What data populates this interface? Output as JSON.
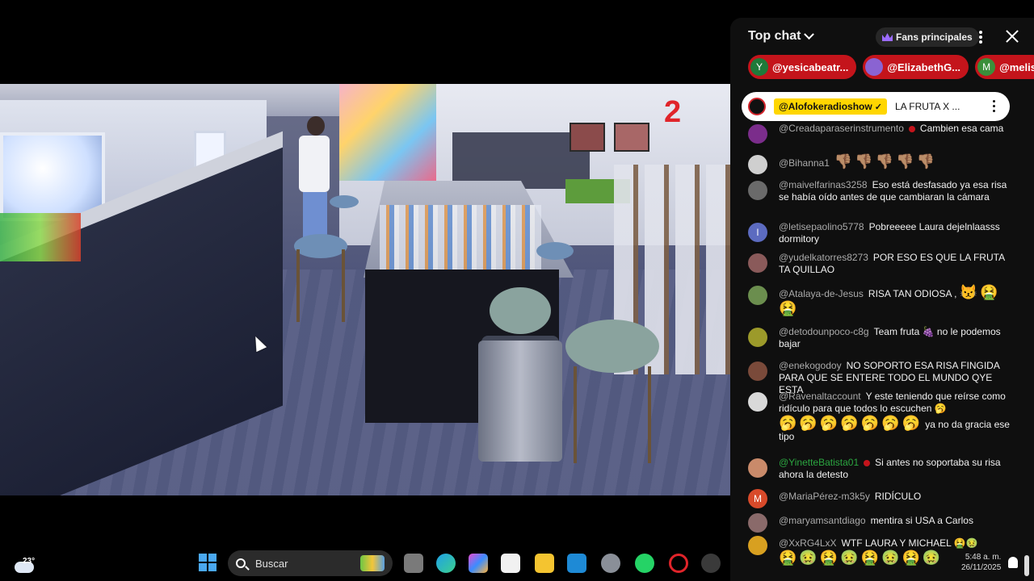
{
  "chat": {
    "title": "Top chat",
    "fans_label": "Fans principales",
    "donors": [
      {
        "initial": "Y",
        "name": "@yesicabeatr...",
        "avatar_color": "#1f7a3a"
      },
      {
        "initial": "",
        "name": "@ElizabethG...",
        "avatar_color": "#8a63d2"
      },
      {
        "initial": "M",
        "name": "@melis",
        "avatar_color": "#3a8f3a"
      }
    ],
    "pinned": {
      "name": "@Alofokeradioshow",
      "check": "✓",
      "text": "LA FRUTA X ..."
    },
    "messages": [
      {
        "author": "@Creadaparaserinstrumento",
        "text": "Cambien esa cama",
        "avatar_color": "#7b2d8b",
        "initial": ""
      },
      {
        "author": "@Bihanna1",
        "text": "",
        "emoji": "👎🏽👎🏽👎🏽👎🏽👎🏽",
        "avatar_color": "#cfcfcf",
        "initial": ""
      },
      {
        "author": "@maivelfarinas3258",
        "text": "Eso está desfasado ya esa risa se había oído antes de que cambiaran la cámara",
        "avatar_color": "#6a6a6a",
        "initial": ""
      },
      {
        "author": "@letisepaolino5778",
        "text": "Pobreeeee Laura dejelnlaasss dormitory",
        "avatar_color": "#5c6bc0",
        "initial": "l"
      },
      {
        "author": "@yudelkatorres8273",
        "text": "POR ESO ES QUE LA FRUTA TA QUILLAO",
        "avatar_color": "#8a5a5a",
        "initial": ""
      },
      {
        "author": "@Atalaya-de-Jesus",
        "text": "RISA TAN ODIOSA ,",
        "emoji": "😾🤮 🤮",
        "avatar_color": "#6b8e4e",
        "initial": ""
      },
      {
        "author": "@detodounpoco-c8g",
        "text": "Team fruta 🍇 no le podemos bajar",
        "avatar_color": "#9c9a2a",
        "initial": ""
      },
      {
        "author": "@enekogodoy",
        "text": "NO SOPORTO ESA RISA FINGIDA PARA QUE SE ENTERE TODO EL MUNDO QYE ESTA",
        "avatar_color": "#7a4a3a",
        "initial": ""
      },
      {
        "author": "@Ravenaltaccount",
        "text": "Y este teniendo que reírse como ridículo para que todos lo escuchen 🥱",
        "emoji": "🥱🥱🥱🥱🥱🥱🥱",
        "tail": "ya no da gracia ese tipo",
        "avatar_color": "#d9d9d9",
        "initial": ""
      },
      {
        "author": "@YinetteBatista01",
        "text": "Si antes no soportaba su risa ahora la detesto",
        "avatar_color": "#c98a6a",
        "initial": "",
        "green": true
      },
      {
        "author": "@MariaPérez-m3k5y",
        "text": "RIDÍCULO",
        "avatar_color": "#d84a2a",
        "initial": "M"
      },
      {
        "author": "@maryamsantdiago",
        "text": "mentira si USA a Carlos",
        "avatar_color": "#8a6a6a",
        "initial": ""
      },
      {
        "author": "@XxRG4LxX",
        "text": "WTF LAURA Y MICHAEL 🤮🤢",
        "emoji": "🤮🤢🤮🤢🤮🤢🤮🤢",
        "avatar_color": "#d8a020",
        "initial": ""
      }
    ]
  },
  "taskbar": {
    "temperature": "23°",
    "search_placeholder": "Buscar",
    "time": "5:48 a. m.",
    "date": "26/11/2025"
  },
  "scene": {
    "number_badge": "2"
  }
}
